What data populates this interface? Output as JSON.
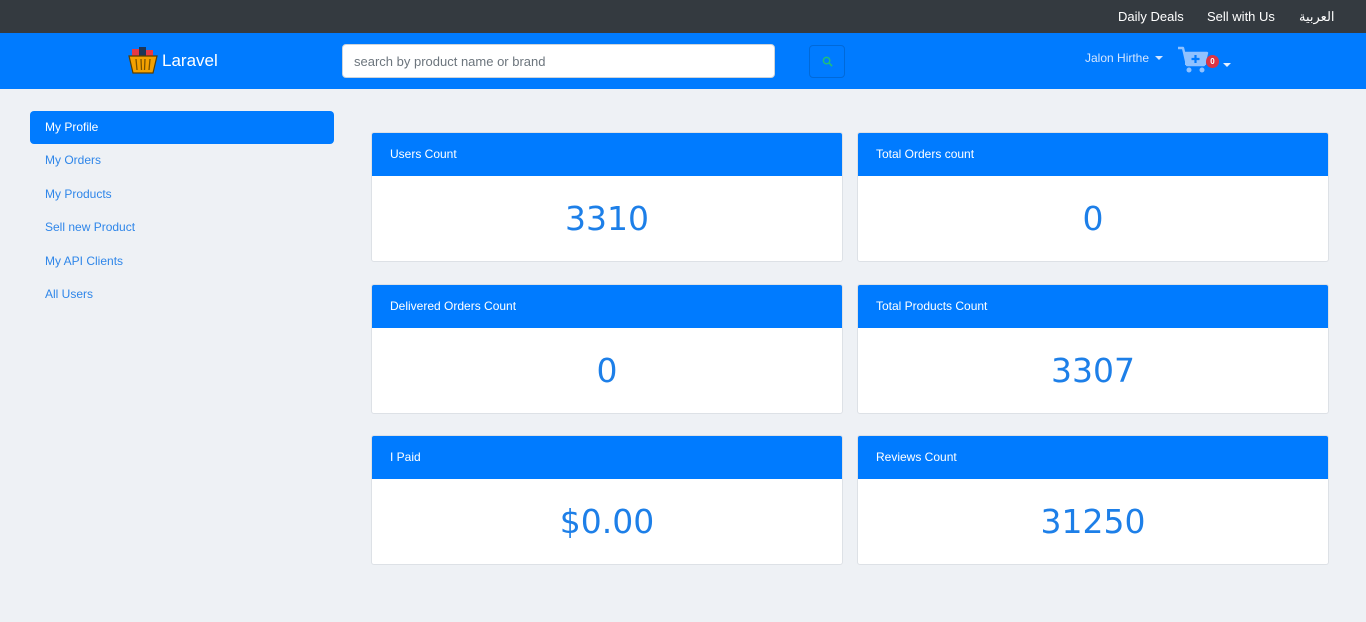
{
  "topbar": {
    "links": [
      "Daily Deals",
      "Sell with Us",
      "العربية"
    ]
  },
  "navbar": {
    "brand": "Laravel",
    "logo_icon": "shopping-basket-icon",
    "search": {
      "placeholder": "search by product name or brand",
      "value": "",
      "button_icon": "search-icon"
    },
    "user_name": "Jalon Hirthe",
    "cart": {
      "icon": "shopping-cart-icon",
      "count": "0"
    }
  },
  "sidebar": {
    "items": [
      {
        "label": "My Profile",
        "active": true
      },
      {
        "label": "My Orders",
        "active": false
      },
      {
        "label": "My Products",
        "active": false
      },
      {
        "label": "Sell new Product",
        "active": false
      },
      {
        "label": "My API Clients",
        "active": false
      },
      {
        "label": "All Users",
        "active": false
      }
    ]
  },
  "stats": [
    {
      "title": "Users Count",
      "value": "3310"
    },
    {
      "title": "Total Orders count",
      "value": "0"
    },
    {
      "title": "Delivered Orders Count",
      "value": "0"
    },
    {
      "title": "Total Products Count",
      "value": "3307"
    },
    {
      "title": "I Paid",
      "value": "$0.00"
    },
    {
      "title": "Reviews Count",
      "value": "31250"
    }
  ],
  "colors": {
    "primary": "#007bff",
    "topbar": "#343a40",
    "background": "#eef1f5",
    "badge": "#dc3545"
  }
}
